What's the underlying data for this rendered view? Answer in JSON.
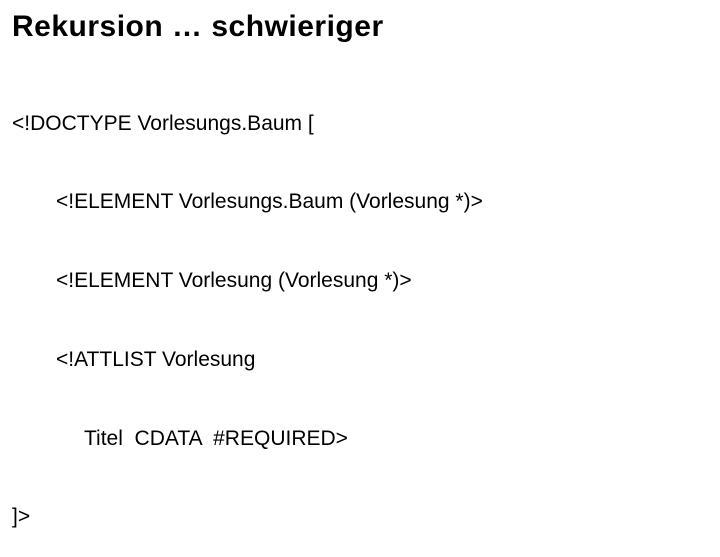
{
  "title": "Rekursion … schwieriger",
  "dtd": {
    "line1": "<!DOCTYPE Vorlesungs.Baum [",
    "line2": "<!ELEMENT Vorlesungs.Baum (Vorlesung *)>",
    "line3": "<!ELEMENT Vorlesung (Vorlesung *)>",
    "line4": "<!ATTLIST Vorlesung",
    "line5": "Titel  CDATA  #REQUIRED>",
    "line6": "]>"
  }
}
